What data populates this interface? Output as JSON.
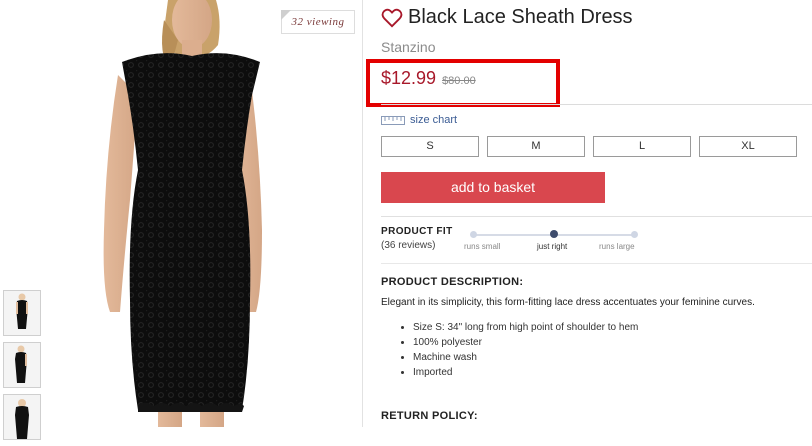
{
  "gallery": {
    "viewing_badge": "32 viewing",
    "thumbnails": [
      "thumbnail-1",
      "thumbnail-2",
      "thumbnail-3"
    ]
  },
  "product": {
    "title": "Black Lace Sheath Dress",
    "brand": "Stanzino",
    "price": "$12.99",
    "old_price": "$80.00",
    "size_chart_label": "size chart",
    "sizes": [
      "S",
      "M",
      "L",
      "XL"
    ],
    "add_to_basket_label": "add to basket",
    "fit": {
      "heading": "PRODUCT FIT",
      "reviews": "(36 reviews)",
      "options": [
        "runs small",
        "just right",
        "runs large"
      ],
      "selected": "just right"
    },
    "description": {
      "heading": "PRODUCT DESCRIPTION:",
      "text": "Elegant in its simplicity, this form-fitting lace dress accentuates your feminine curves.",
      "bullets": [
        "Size S: 34\" long from high point of shoulder to hem",
        "100% polyester",
        "Machine wash",
        "Imported"
      ]
    },
    "return_policy_heading": "RETURN POLICY:"
  },
  "icons": {
    "heart": "heart-outline-icon",
    "size_chart": "ruler-icon"
  },
  "colors": {
    "price": "#a8182a",
    "add_button": "#d9474e",
    "link": "#3b5c94",
    "highlight_box": "#e30000",
    "heart": "#a8182a"
  }
}
